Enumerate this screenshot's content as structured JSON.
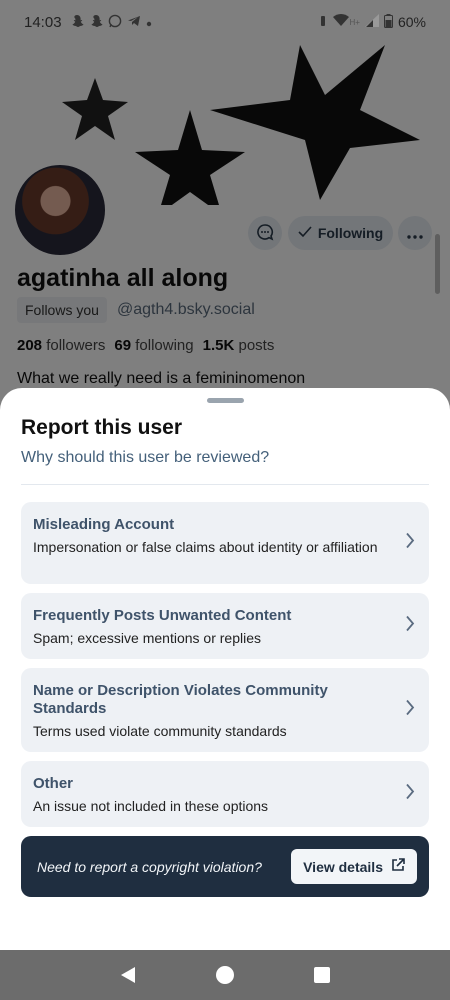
{
  "status_bar": {
    "time": "14:03",
    "battery": "60%",
    "network_label": "H+",
    "app_icons": [
      "snapchat-icon",
      "snapchat-icon",
      "whatsapp-icon",
      "telegram-icon",
      "dot-icon"
    ]
  },
  "profile": {
    "display_name": "agatinha all along",
    "follows_you": "Follows you",
    "handle": "@agth4.bsky.social",
    "followers_count": "208",
    "followers_label": "followers",
    "following_count": "69",
    "following_label": "following",
    "posts_count": "1.5K",
    "posts_label": "posts",
    "bio": "What we really need is a femininomenon",
    "follow_button": "Following"
  },
  "sheet": {
    "title": "Report this user",
    "subtitle": "Why should this user be reviewed?",
    "options": [
      {
        "title": "Misleading Account",
        "description": "Impersonation or false claims about identity or affiliation"
      },
      {
        "title": "Frequently Posts Unwanted Content",
        "description": "Spam; excessive mentions or replies"
      },
      {
        "title": "Name or Description Violates Community Standards",
        "description": "Terms used violate community standards"
      },
      {
        "title": "Other",
        "description": "An issue not included in these options"
      }
    ],
    "copyright_text": "Need to report a copyright violation?",
    "copyright_button": "View details"
  },
  "colors": {
    "accent": "#3f536a",
    "dark_banner": "#1f2e40",
    "option_bg": "#eef1f5"
  }
}
